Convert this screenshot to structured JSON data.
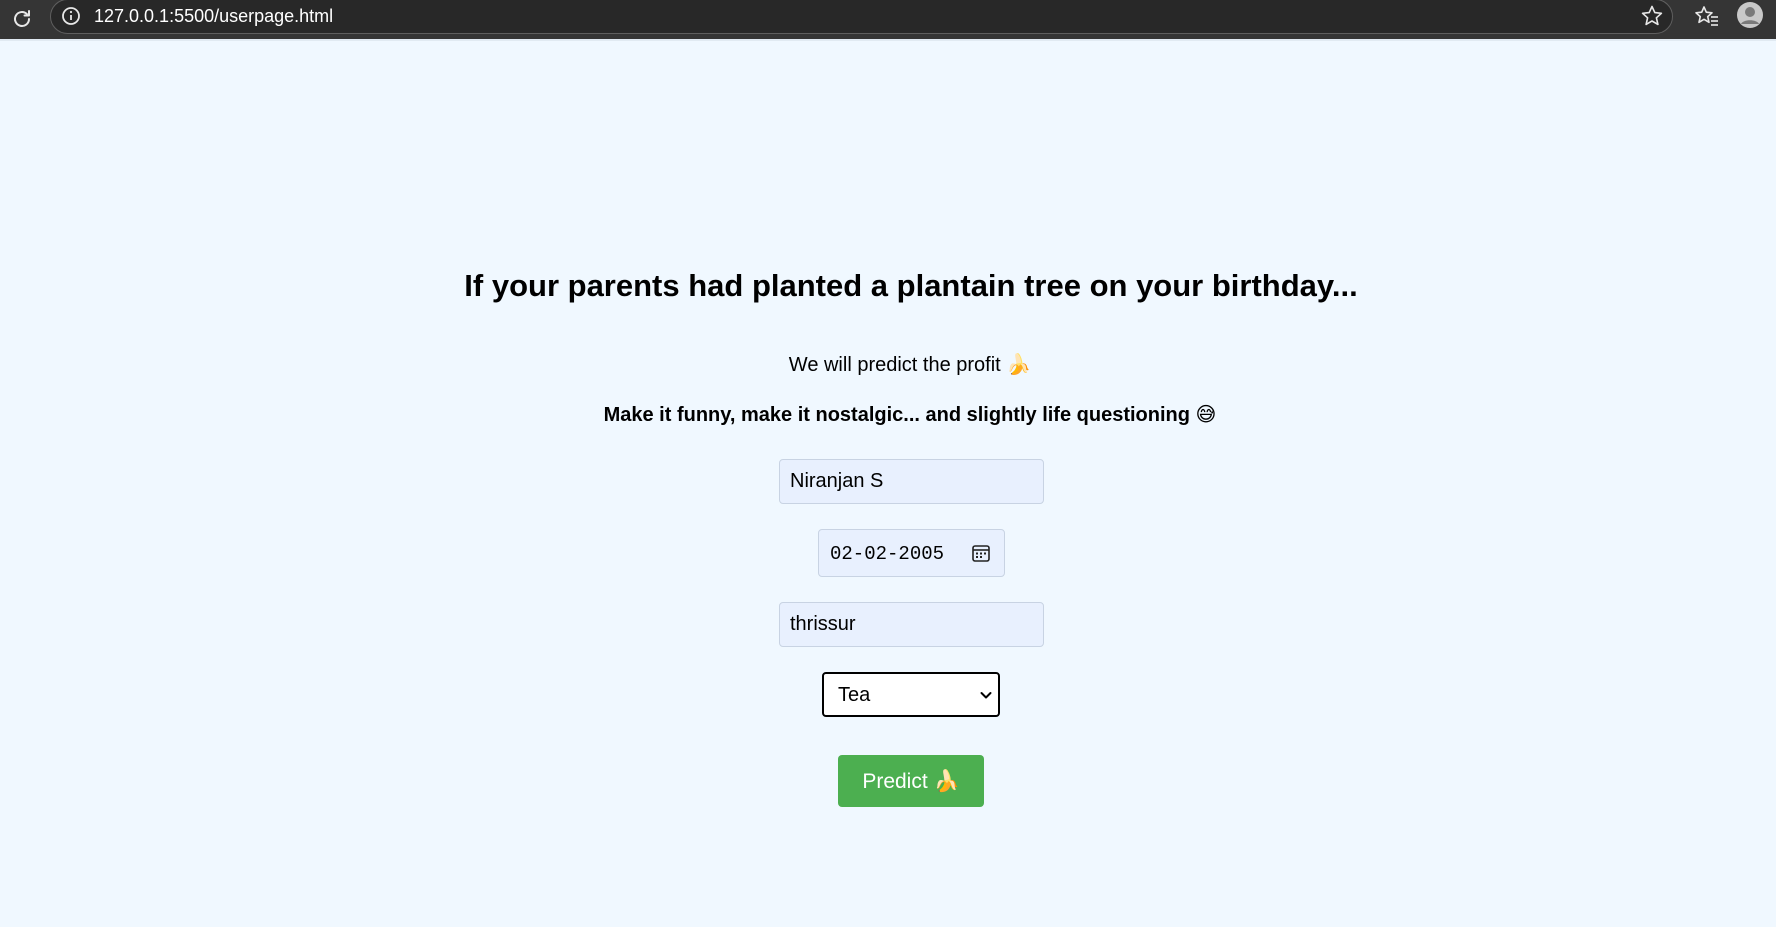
{
  "browser": {
    "url": "127.0.0.1:5500/userpage.html"
  },
  "page": {
    "title": "If your parents had planted a plantain tree on your birthday...",
    "subtitle": "We will predict the profit",
    "subtitle_emoji": "🍌",
    "tagline": "Make it funny, make it nostalgic... and slightly life questioning",
    "tagline_emoji": "😅"
  },
  "form": {
    "name_value": "Niranjan S",
    "dob_value": "02-02-2005",
    "place_value": "thrissur",
    "crop_selected": "Tea",
    "submit_label": "Predict",
    "submit_emoji": "🍌"
  },
  "icons": [
    "reload-icon",
    "info-icon",
    "star-icon",
    "favorites-icon",
    "profile-icon",
    "calendar-icon",
    "chevron-down-icon"
  ]
}
